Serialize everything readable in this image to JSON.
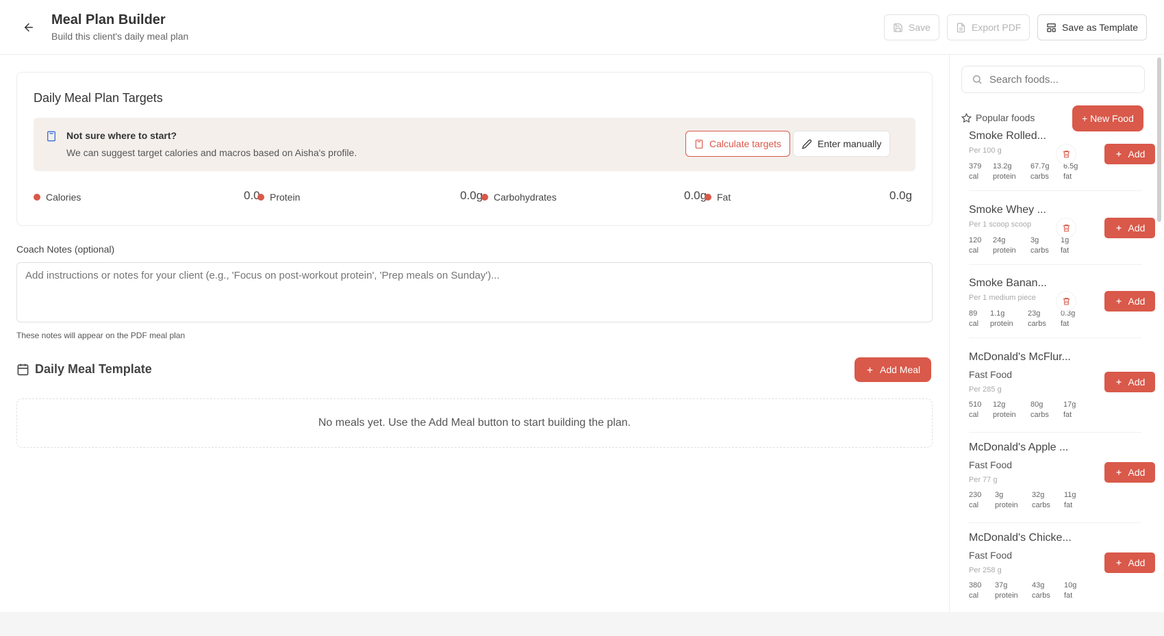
{
  "header": {
    "title": "Meal Plan Builder",
    "subtitle": "Build this client's daily meal plan",
    "save_label": "Save",
    "export_label": "Export PDF",
    "template_label": "Save as Template"
  },
  "targets": {
    "title": "Daily Meal Plan Targets",
    "hint_title": "Not sure where to start?",
    "hint_text": "We can suggest target calories and macros based on Aisha's profile.",
    "calc_label": "Calculate targets",
    "manual_label": "Enter manually",
    "macros": [
      {
        "label": "Calories",
        "value": "0.0"
      },
      {
        "label": "Protein",
        "value": "0.0g"
      },
      {
        "label": "Carbohydrates",
        "value": "0.0g"
      },
      {
        "label": "Fat",
        "value": "0.0g"
      }
    ]
  },
  "notes": {
    "label": "Coach Notes (optional)",
    "placeholder": "Add instructions or notes for your client (e.g., 'Focus on post-workout protein', 'Prep meals on Sunday')...",
    "help": "These notes will appear on the PDF meal plan"
  },
  "template": {
    "title": "Daily Meal Template",
    "add_meal_label": "Add Meal",
    "empty_text": "No meals yet. Use the Add Meal button to start building the plan."
  },
  "sidebar": {
    "search_placeholder": "Search foods...",
    "popular_label": "Popular foods",
    "new_food_label": "+ New Food",
    "add_label": "Add",
    "foods": [
      {
        "name": "Smoke Rolled...",
        "category": "",
        "per": "Per 100 g",
        "cal": "379",
        "protein": "13.2g",
        "carbs": "67.7g",
        "fat": "6.5g",
        "deletable": true
      },
      {
        "name": "Smoke Whey ...",
        "category": "",
        "per": "Per 1 scoop scoop",
        "cal": "120",
        "protein": "24g",
        "carbs": "3g",
        "fat": "1g",
        "deletable": true
      },
      {
        "name": "Smoke Banan...",
        "category": "",
        "per": "Per 1 medium piece",
        "cal": "89",
        "protein": "1.1g",
        "carbs": "23g",
        "fat": "0.3g",
        "deletable": true
      },
      {
        "name": "McDonald's McFlur...",
        "category": "Fast Food",
        "per": "Per 285 g",
        "cal": "510",
        "protein": "12g",
        "carbs": "80g",
        "fat": "17g",
        "deletable": false
      },
      {
        "name": "McDonald's Apple ...",
        "category": "Fast Food",
        "per": "Per 77 g",
        "cal": "230",
        "protein": "3g",
        "carbs": "32g",
        "fat": "11g",
        "deletable": false
      },
      {
        "name": "McDonald's Chicke...",
        "category": "Fast Food",
        "per": "Per 258 g",
        "cal": "380",
        "protein": "37g",
        "carbs": "43g",
        "fat": "10g",
        "deletable": false
      }
    ],
    "units": {
      "cal": "cal",
      "protein": "protein",
      "carbs": "carbs",
      "fat": "fat"
    }
  },
  "colors": {
    "accent": "#d9594a",
    "hint_bg": "#f4efeb"
  }
}
